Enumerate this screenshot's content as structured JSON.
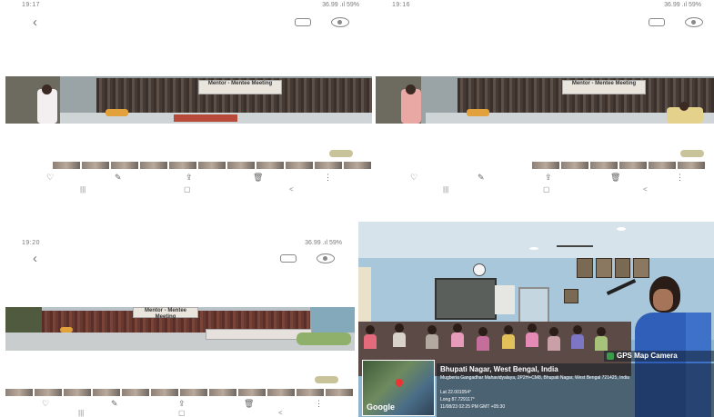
{
  "tiles": [
    {
      "status_time": "19:17",
      "status_right": "36.99 .ıl 59%"
    },
    {
      "status_time": "19:16",
      "status_right": "36.99 .ıl 59%"
    },
    {
      "status_time": "19:20",
      "status_right": "36.99 .ıl 59%"
    }
  ],
  "icons": {
    "back": "‹",
    "actions": [
      "♡",
      "✎",
      "⇪",
      "🗑",
      "⋮"
    ],
    "nav": [
      "|||",
      "▢",
      "<"
    ]
  },
  "banner_text": "Mentor - Mentee Meeting",
  "gps": {
    "app_label": "GPS Map Camera",
    "place": "Bhupati Nagar, West Bengal, India",
    "address": "Mugberia Gangadhar Mahavidyalaya, 2P2H+CM8, Bhupati Nagar, West Bengal 721425, India",
    "lat": "Lat 22.001054°",
    "long": "Long 87.729117°",
    "datetime": "11/08/23 02:25 PM GMT +05:30",
    "map_brand": "Google"
  },
  "colors": {
    "accent": "#c9c399",
    "wall": "#a9c7da",
    "saree": "#2f5fb8"
  }
}
